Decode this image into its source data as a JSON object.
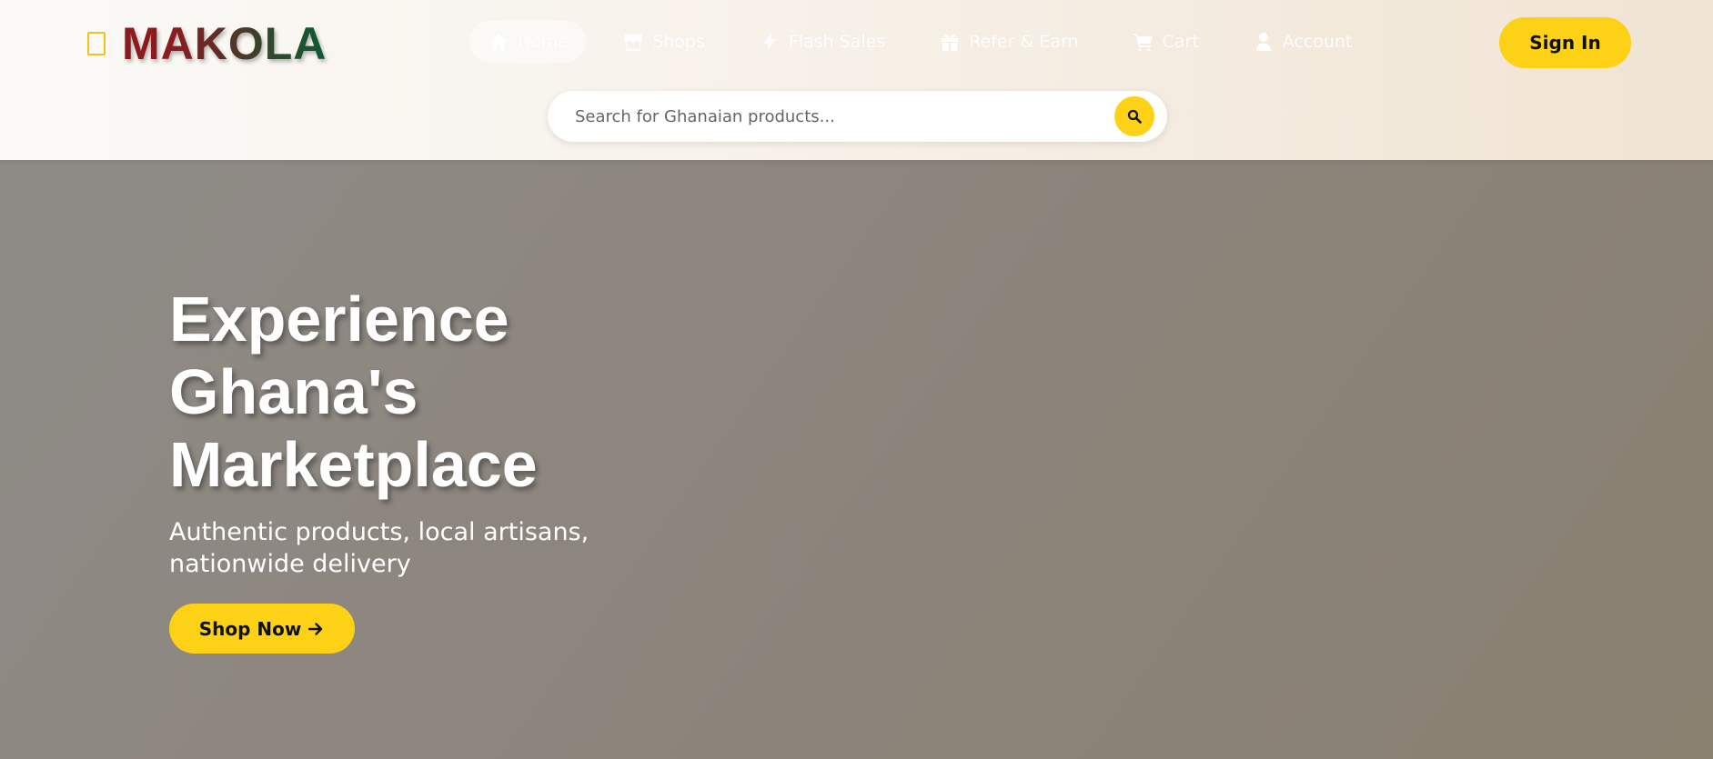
{
  "brand": {
    "name": "MAKOLA"
  },
  "nav": {
    "items": [
      {
        "label": "Home",
        "icon": "home-icon",
        "active": true
      },
      {
        "label": "Shops",
        "icon": "store-icon",
        "active": false
      },
      {
        "label": "Flash Sales",
        "icon": "bolt-icon",
        "active": false
      },
      {
        "label": "Refer & Earn",
        "icon": "gift-icon",
        "active": false
      },
      {
        "label": "Cart",
        "icon": "cart-icon",
        "active": false
      },
      {
        "label": "Account",
        "icon": "user-icon",
        "active": false
      }
    ]
  },
  "header": {
    "signin_label": "Sign In"
  },
  "search": {
    "placeholder": "Search for Ghanaian products...",
    "value": ""
  },
  "hero": {
    "title_lines": [
      "Experience",
      "Ghana's",
      "Marketplace"
    ],
    "subtitle": "Authentic products, local artisans, nationwide delivery",
    "cta_label": "Shop Now"
  },
  "colors": {
    "accent": "#fcd116",
    "brand_red": "#8c1b1e",
    "brand_green": "#0f5a32",
    "hero_bg": "#8d857d"
  }
}
